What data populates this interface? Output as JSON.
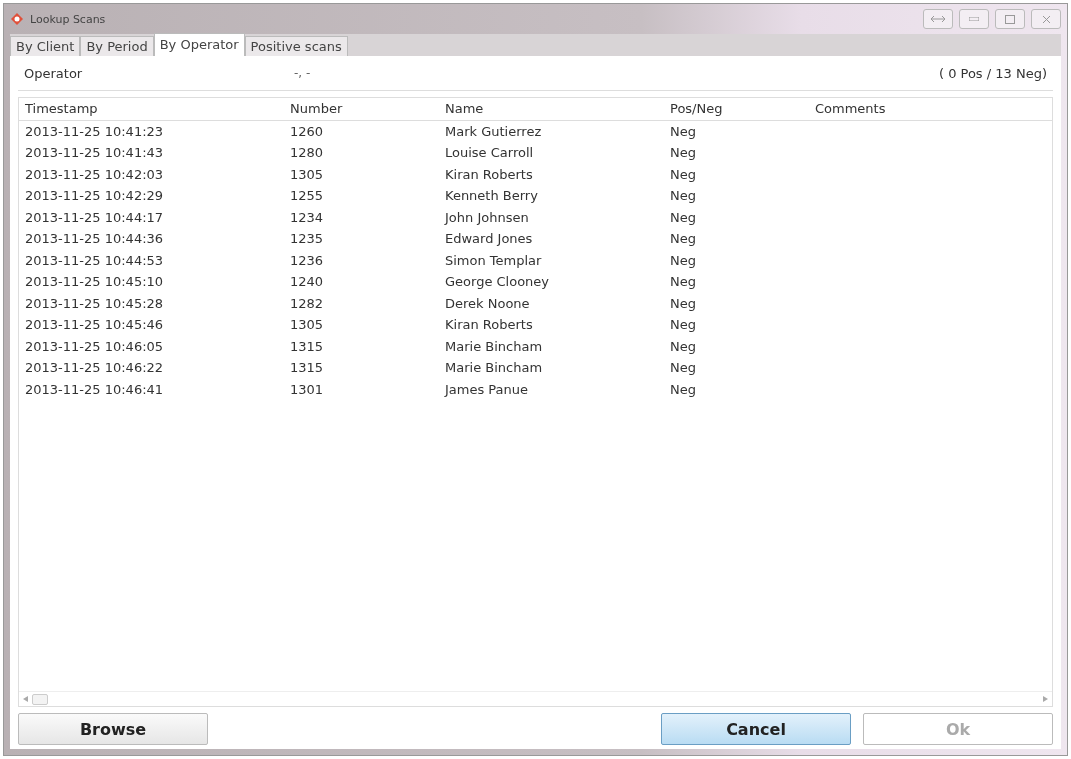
{
  "window": {
    "title": "Lookup Scans"
  },
  "tabs": [
    {
      "label": "By Client",
      "selected": false
    },
    {
      "label": "By Period",
      "selected": false
    },
    {
      "label": "By Operator",
      "selected": true
    },
    {
      "label": "Positive scans",
      "selected": false
    }
  ],
  "operator": {
    "label": "Operator",
    "value": "-, -",
    "summary": "( 0 Pos / 13 Neg)"
  },
  "table": {
    "columns": [
      "Timestamp",
      "Number",
      "Name",
      "Pos/Neg",
      "Comments"
    ],
    "rows": [
      [
        "2013-11-25 10:41:23",
        "1260",
        "Mark Gutierrez",
        "Neg"
      ],
      [
        "2013-11-25 10:41:43",
        "1280",
        "Louise Carroll",
        "Neg"
      ],
      [
        "2013-11-25 10:42:03",
        "1305",
        "Kiran Roberts",
        "Neg"
      ],
      [
        "2013-11-25 10:42:29",
        "1255",
        "Kenneth Berry",
        "Neg"
      ],
      [
        "2013-11-25 10:44:17",
        "1234",
        "John Johnsen",
        "Neg"
      ],
      [
        "2013-11-25 10:44:36",
        "1235",
        "Edward Jones",
        "Neg"
      ],
      [
        "2013-11-25 10:44:53",
        "1236",
        "Simon Templar",
        "Neg"
      ],
      [
        "2013-11-25 10:45:10",
        "1240",
        "George Clooney",
        "Neg"
      ],
      [
        "2013-11-25 10:45:28",
        "1282",
        "Derek Noone",
        "Neg"
      ],
      [
        "2013-11-25 10:45:46",
        "1305",
        "Kiran Roberts",
        "Neg"
      ],
      [
        "2013-11-25 10:46:05",
        "1315",
        "Marie Bincham",
        "Neg"
      ],
      [
        "2013-11-25 10:46:22",
        "1315",
        "Marie Bincham",
        "Neg"
      ],
      [
        "2013-11-25 10:46:41",
        "1301",
        "James Panue",
        "Neg"
      ]
    ]
  },
  "buttons": [
    {
      "label": "Browse",
      "kind": "normal",
      "disabled": false
    },
    {
      "label": "Cancel",
      "kind": "default",
      "disabled": false
    },
    {
      "label": "Ok",
      "kind": "normal",
      "disabled": true
    }
  ]
}
